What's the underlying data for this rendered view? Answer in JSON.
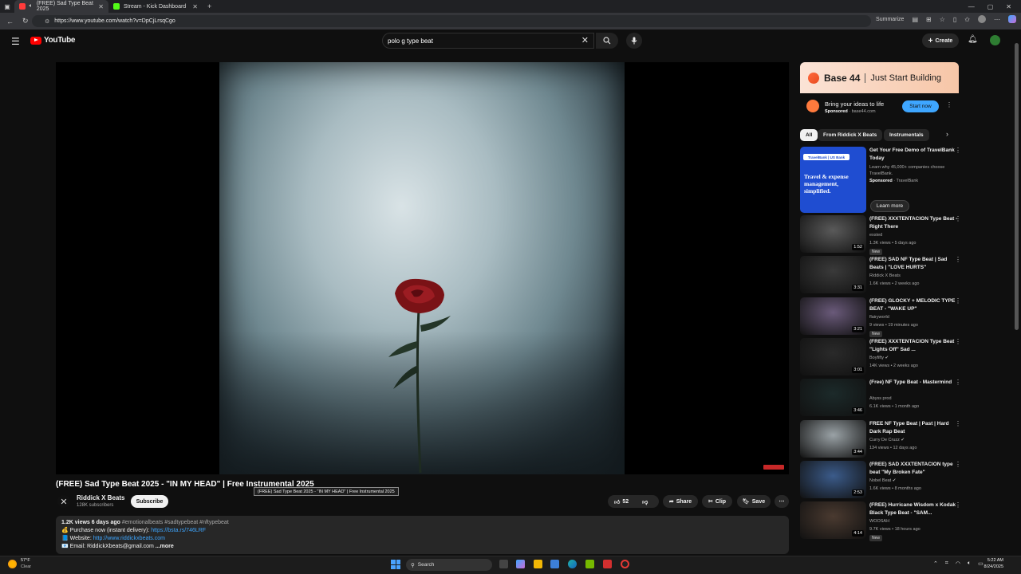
{
  "browser": {
    "tabs": [
      {
        "title": "(FREE) Sad Type Beat 2025",
        "color": "#ff3b3b"
      },
      {
        "title": "Stream - Kick Dashboard",
        "color": "#53fc18"
      }
    ],
    "url": "https://www.youtube.com/watch?v=DpCjLrsqCgo",
    "summarize_label": "Summarize"
  },
  "header": {
    "logo_text": "YouTube",
    "search_value": "polo g type beat",
    "create_label": "Create"
  },
  "video": {
    "title": "(FREE) Sad Type Beat 2025 - \"IN MY HEAD\" | Free Instrumental 2025",
    "tooltip": "(FREE) Sad Type Beat 2025 - \"IN MY HEAD\" | Free Instrumental 2025",
    "channel": "Riddick X Beats",
    "subscribers": "128K subscribers",
    "subscribe_label": "Subscribe",
    "likes": "52",
    "share_label": "Share",
    "clip_label": "Clip",
    "save_label": "Save",
    "description": {
      "stats": "1.2K views  6 days ago",
      "tags": "#emotionalbeats #sadtypebeat #nftypebeat",
      "purchase_label": "💰 Purchase now (instant delivery):",
      "purchase_link": "https://bsta.rs/746LRF",
      "website_label": "📘 Website:",
      "website_link": "http://www.riddickxbeats.com",
      "email_line": "📧 Email: RiddickXbeats@gmail.com",
      "more": "...more"
    }
  },
  "ad": {
    "brand": "Base 44",
    "tagline": "Just Start Building",
    "headline": "Bring your ideas to life",
    "sponsored": "Sponsored",
    "domain": "base44.com",
    "cta": "Start now"
  },
  "chips": [
    "All",
    "From Riddick X Beats",
    "Instrumentals"
  ],
  "sidebar_ad": {
    "title": "Get Your Free Demo of TravelBank Today",
    "desc": "Learn why 45,000+ companies choose TravelBank.",
    "sponsored": "Sponsored",
    "advertiser": "TravelBank",
    "thumb_logo": "TravelBank | US Bank",
    "thumb_text": "Travel & expense management, simplified.",
    "cta": "Learn more"
  },
  "recommendations": [
    {
      "title": "(FREE) XXXTENTACION Type Beat - Right There",
      "channel": "exsted",
      "meta": "1.3K views • 5 days ago",
      "duration": "1:52",
      "badge": "New",
      "thumb": "#5a5a5a"
    },
    {
      "title": "(FREE) SAD NF Type Beat | Sad Beats | \"LOVE HURTS\"",
      "channel": "Riddick X Beats",
      "meta": "1.6K views • 2 weeks ago",
      "duration": "3:31",
      "badge": "",
      "thumb": "#3a3a3a"
    },
    {
      "title": "(FREE) GLOCKY + MELODIC TYPE BEAT - \"WAKE UP\"",
      "channel": "flairyworld",
      "meta": "9 views • 19 minutes ago",
      "duration": "3:21",
      "badge": "New",
      "thumb": "#6a5a7a"
    },
    {
      "title": "(FREE) XXXTENTACION Type Beat \"Lights Off\" Sad ...",
      "channel": "Boyfifty ✔",
      "meta": "14K views • 2 weeks ago",
      "duration": "3:01",
      "badge": "",
      "thumb": "#2a2a2a"
    },
    {
      "title": "(Free) NF Type Beat - Mastermind",
      "channel": "Abyss prod",
      "meta": "6.1K views • 1 month ago",
      "duration": "3:46",
      "badge": "",
      "thumb": "#1c2a2a"
    },
    {
      "title": "FREE NF Type Beat | Past | Hard Dark Rap Beat",
      "channel": "Curry De Cruzz ✔",
      "meta": "134 views • 12 days ago",
      "duration": "3:44",
      "badge": "",
      "thumb": "#9aa2a6"
    },
    {
      "title": "(FREE) SAD XXXTENTACION type beat \"My Broken Fate\"",
      "channel": "Nobel Beat ✔",
      "meta": "1.6K views • 8 months ago",
      "duration": "2:53",
      "badge": "",
      "thumb": "#3b5b8a"
    },
    {
      "title": "(FREE) Hurricane Wisdom x Kodak Black Type Beat - \"SAM...",
      "channel": "WOOSAH",
      "meta": "9.7K views • 18 hours ago",
      "duration": "4:14",
      "badge": "New",
      "thumb": "#4a3a30"
    }
  ],
  "taskbar": {
    "temp": "57°F",
    "weather": "Clear",
    "search_label": "Search",
    "time": "5:22 AM",
    "date": "8/24/2025"
  }
}
